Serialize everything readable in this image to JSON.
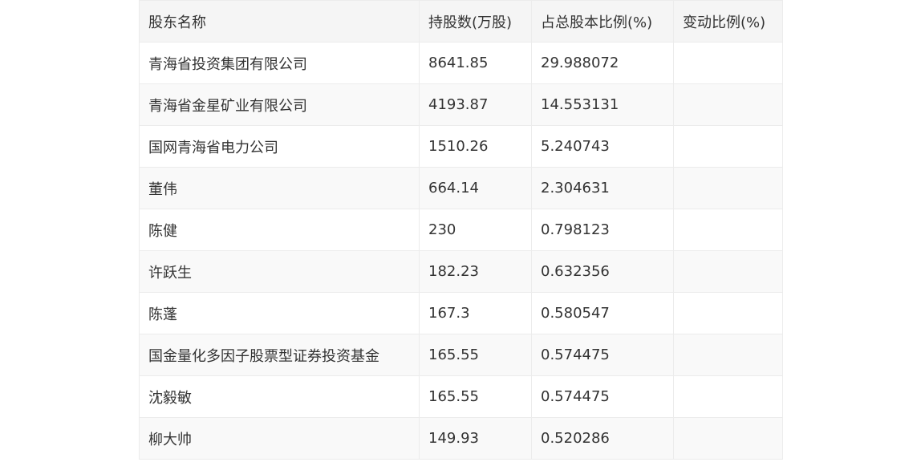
{
  "table": {
    "headers": [
      "股东名称",
      "持股数(万股)",
      "占总股本比例(%)",
      "变动比例(%)"
    ],
    "rows": [
      [
        "青海省投资集团有限公司",
        "8641.85",
        "29.988072",
        ""
      ],
      [
        "青海省金星矿业有限公司",
        "4193.87",
        "14.553131",
        ""
      ],
      [
        "国网青海省电力公司",
        "1510.26",
        "5.240743",
        ""
      ],
      [
        "董伟",
        "664.14",
        "2.304631",
        ""
      ],
      [
        "陈健",
        "230",
        "0.798123",
        ""
      ],
      [
        "许跃生",
        "182.23",
        "0.632356",
        ""
      ],
      [
        "陈蓬",
        "167.3",
        "0.580547",
        ""
      ],
      [
        "国金量化多因子股票型证券投资基金",
        "165.55",
        "0.574475",
        ""
      ],
      [
        "沈毅敏",
        "165.55",
        "0.574475",
        ""
      ],
      [
        "柳大帅",
        "149.93",
        "0.520286",
        ""
      ]
    ]
  }
}
